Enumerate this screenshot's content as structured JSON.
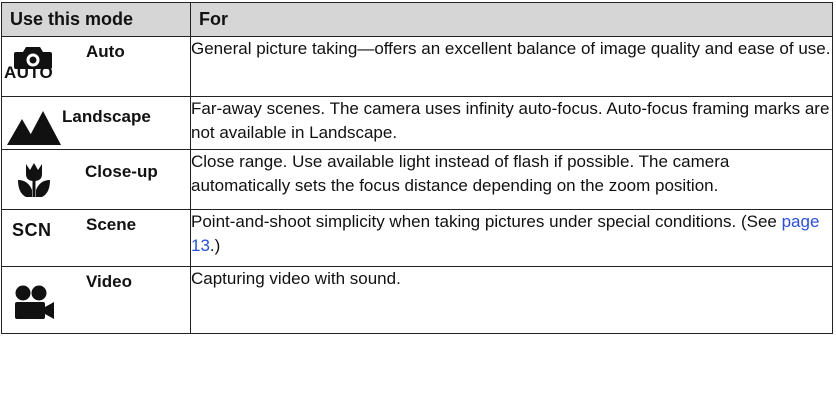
{
  "table": {
    "headers": [
      "Use this mode",
      "For"
    ],
    "rows": [
      {
        "icon": "camera-icon",
        "icon_text": "AUTO",
        "mode": "Auto",
        "description": "General picture taking—offers an excellent balance of image quality and ease of use."
      },
      {
        "icon": "mountains-icon",
        "mode": "Landscape",
        "description": "Far-away scenes. The camera uses infinity auto-focus. Auto-focus framing marks are not available in Landscape."
      },
      {
        "icon": "flower-icon",
        "mode": "Close-up",
        "description": "Close range. Use available light instead of flash if possible. The camera automatically sets the focus distance depending on the zoom position."
      },
      {
        "icon_text": "SCN",
        "mode": "Scene",
        "description_before": "Point-and-shoot simplicity when taking pictures under special conditions. (See ",
        "description_link": "page 13",
        "description_after": ".)"
      },
      {
        "icon": "video-camera-icon",
        "mode": "Video",
        "description": "Capturing video with sound."
      }
    ]
  },
  "colors": {
    "header_bg": "#d6d6d6",
    "border": "#222222",
    "link": "#2a4fd4"
  }
}
